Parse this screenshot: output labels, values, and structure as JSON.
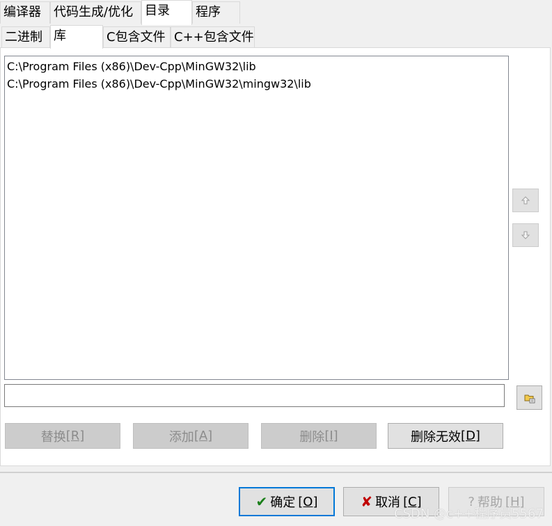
{
  "top_tabs": [
    {
      "label": "编译器"
    },
    {
      "label": "代码生成/优化"
    },
    {
      "label": "目录"
    },
    {
      "label": "程序"
    }
  ],
  "sub_tabs": [
    {
      "label": "二进制"
    },
    {
      "label": "库"
    },
    {
      "label": "C包含文件"
    },
    {
      "label": "C++包含文件"
    }
  ],
  "directories": [
    "C:\\Program Files (x86)\\Dev-Cpp\\MinGW32\\lib",
    "C:\\Program Files (x86)\\Dev-Cpp\\MinGW32\\mingw32\\lib"
  ],
  "path_input": {
    "value": ""
  },
  "actions": {
    "replace": {
      "label": "替换",
      "key": "[R]"
    },
    "add": {
      "label": "添加",
      "key": "[A]"
    },
    "delete": {
      "label": "删除",
      "key": "[I]"
    },
    "delete_invalid": {
      "label": "删除无效",
      "key": "[D]"
    }
  },
  "footer": {
    "ok": {
      "label": "确定",
      "key": "[O]"
    },
    "cancel": {
      "label": "取消",
      "key": "[C]"
    },
    "help": {
      "label": "帮助",
      "key": "[H]"
    }
  },
  "watermark": "CSDN @c++程序员5567",
  "icons": {
    "up": "arrow-up-icon",
    "down": "arrow-down-icon",
    "browse": "folder-browse-icon",
    "ok": "check-icon",
    "cancel": "x-icon",
    "help": "question-icon"
  },
  "colors": {
    "ok_check": "#1a7f1a",
    "cancel_x": "#c00000",
    "default_border": "#0078d7"
  }
}
